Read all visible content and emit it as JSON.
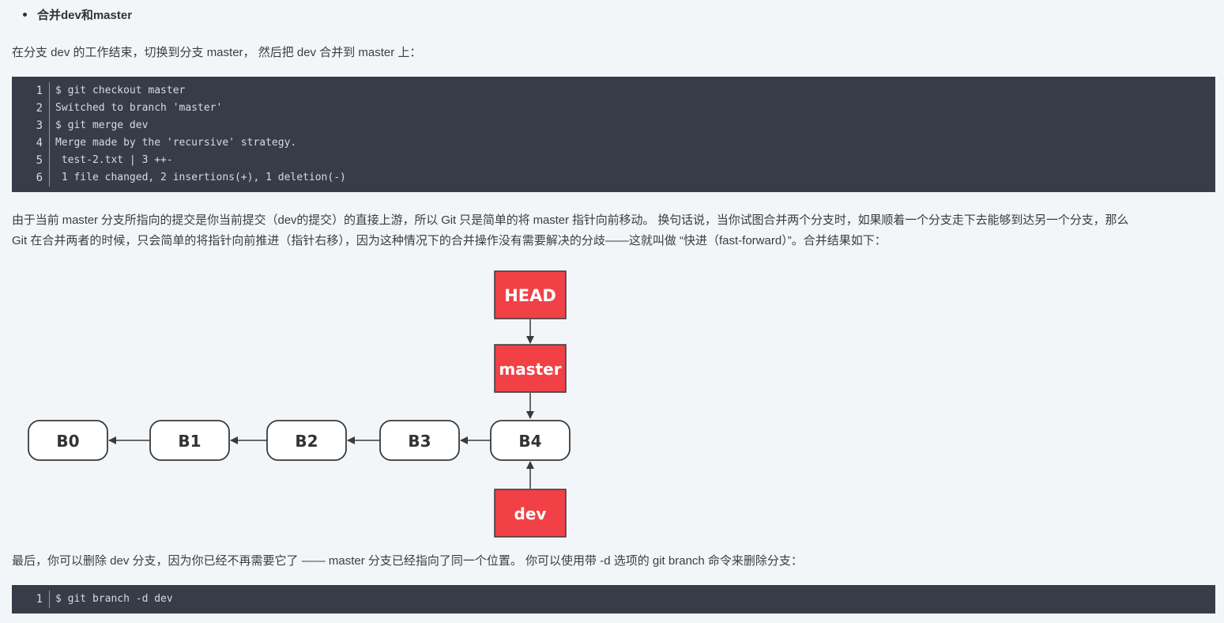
{
  "heading": "合并dev和master",
  "intro": "在分支 dev 的工作结束，切换到分支 master， 然后把 dev 合并到 master 上：",
  "code_block_1": {
    "lines": [
      {
        "num": "1",
        "text": "$ git checkout master"
      },
      {
        "num": "2",
        "text": "Switched to branch 'master'"
      },
      {
        "num": "3",
        "text": "$ git merge dev"
      },
      {
        "num": "4",
        "text": "Merge made by the 'recursive' strategy."
      },
      {
        "num": "5",
        "text": " test-2.txt | 3 ++-"
      },
      {
        "num": "6",
        "text": " 1 file changed, 2 insertions(+), 1 deletion(-)"
      }
    ]
  },
  "explanation_line1": "由于当前 master 分支所指向的提交是你当前提交（dev的提交）的直接上游，所以 Git 只是简单的将 master 指针向前移动。 换句话说，当你试图合并两个分支时，如果顺着一个分支走下去能够到达另一个分支，那么",
  "explanation_line2": "Git 在合并两者的时候，只会简单的将指针向前推进（指针右移），因为这种情况下的合并操作没有需要解决的分歧——这就叫做 “快进（fast-forward）”。合并结果如下：",
  "diagram": {
    "commits": [
      "B0",
      "B1",
      "B2",
      "B3",
      "B4"
    ],
    "head_label": "HEAD",
    "master_label": "master",
    "dev_label": "dev",
    "ref_color": "#f14146",
    "commit_border": "#3a3a3a"
  },
  "closing": "最后，你可以删除 dev 分支，因为你已经不再需要它了 —— master 分支已经指向了同一个位置。 你可以使用带 -d 选项的 git branch 命令来删除分支：",
  "code_block_2": {
    "lines": [
      {
        "num": "1",
        "text": "$ git branch -d dev"
      }
    ]
  }
}
